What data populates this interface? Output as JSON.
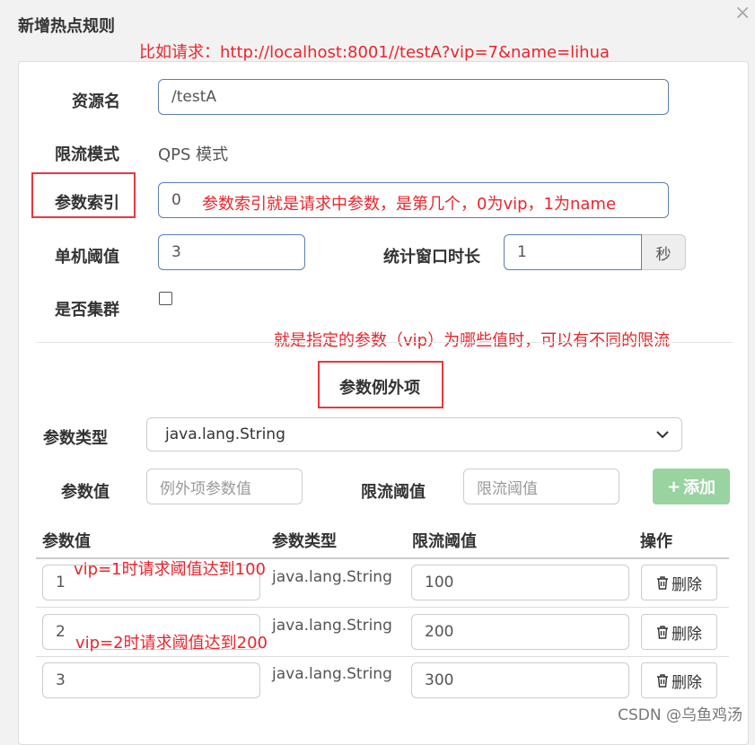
{
  "dialog": {
    "title": "新增热点规则",
    "close": "×"
  },
  "annotations": {
    "request_example": "比如请求：http://localhost:8001//testA?vip=7&name=lihua",
    "param_index_note": "参数索引就是请求中参数，是第几个，0为vip，1为name",
    "exception_note": "就是指定的参数（vip）为哪些值时，可以有不同的限流",
    "row1_note": "vip=1时请求阈值达到100",
    "row2_note": "vip=2时请求阈值达到200"
  },
  "form": {
    "resource_label": "资源名",
    "resource_value": "/testA",
    "mode_label": "限流模式",
    "mode_value": "QPS 模式",
    "param_index_label": "参数索引",
    "param_index_value": "0",
    "threshold_label": "单机阈值",
    "threshold_value": "3",
    "window_label": "统计窗口时长",
    "window_value": "1",
    "window_unit": "秒",
    "cluster_label": "是否集群"
  },
  "exceptions": {
    "section_title": "参数例外项",
    "type_label": "参数类型",
    "type_selected": "java.lang.String",
    "value_label": "参数值",
    "value_placeholder": "例外项参数值",
    "limit_label": "限流阈值",
    "limit_placeholder": "限流阈值",
    "add_button": "添加",
    "add_icon": "+"
  },
  "table": {
    "headers": [
      "参数值",
      "参数类型",
      "限流阈值",
      "操作"
    ],
    "rows": [
      {
        "value": "1",
        "type": "java.lang.String",
        "limit": "100",
        "action": "删除"
      },
      {
        "value": "2",
        "type": "java.lang.String",
        "limit": "200",
        "action": "删除"
      },
      {
        "value": "3",
        "type": "java.lang.String",
        "limit": "300",
        "action": "删除"
      }
    ]
  },
  "watermark": "CSDN @乌鱼鸡汤"
}
